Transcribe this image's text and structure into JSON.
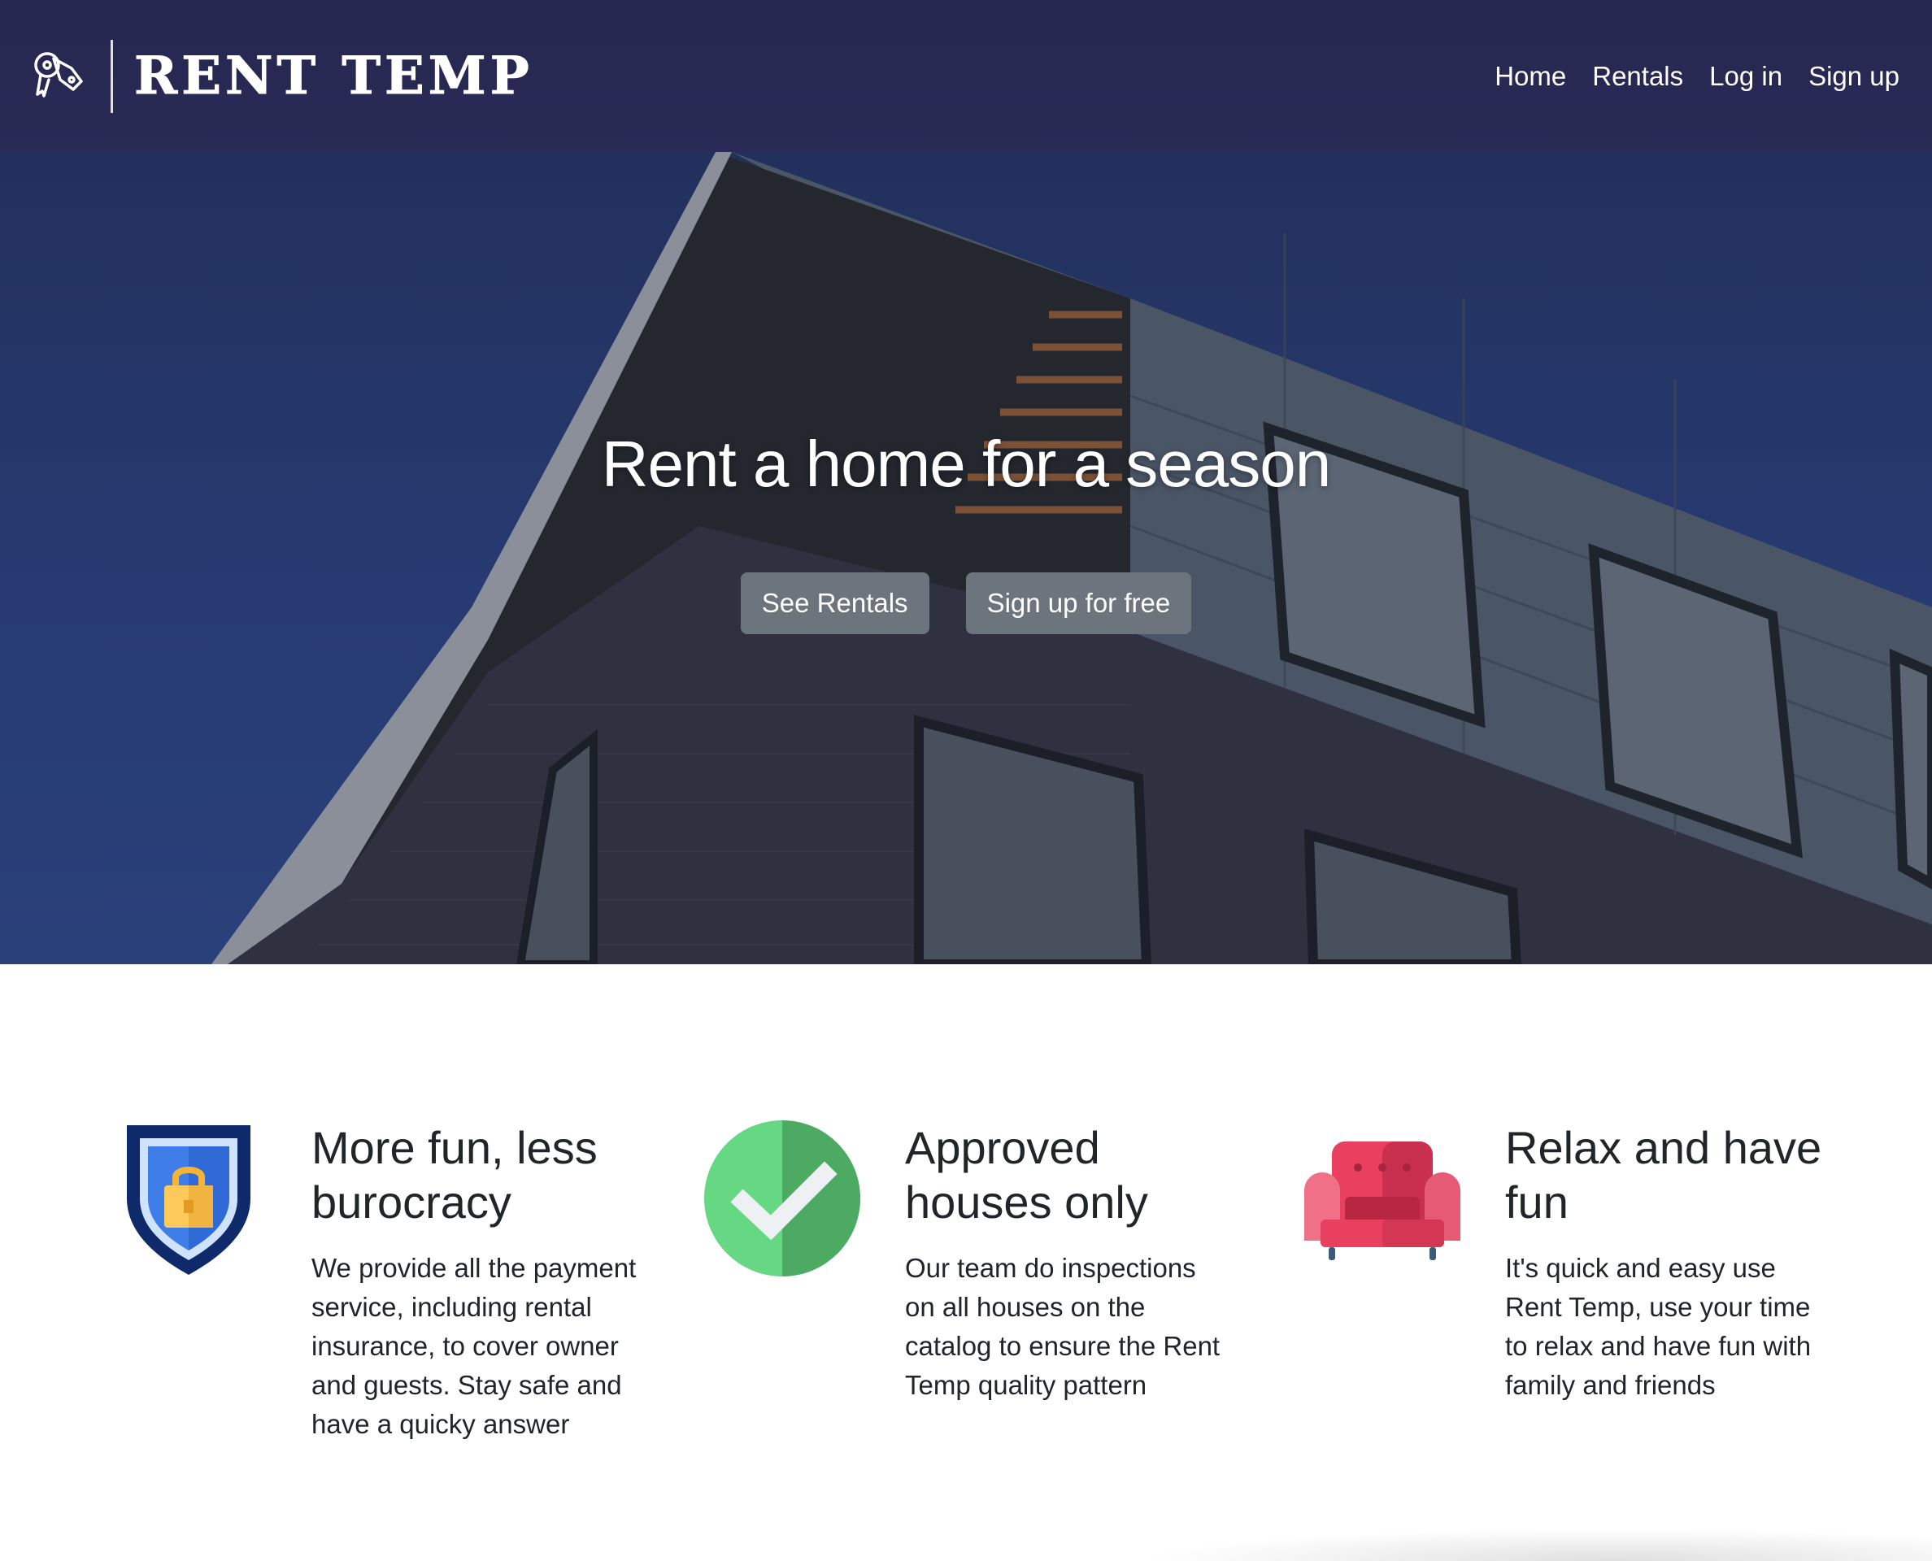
{
  "navbar": {
    "brand_name": "RENT TEMP",
    "logo_icon": "keys-icon",
    "links": [
      {
        "label": "Home"
      },
      {
        "label": "Rentals"
      },
      {
        "label": "Log in"
      },
      {
        "label": "Sign up"
      }
    ]
  },
  "hero": {
    "title": "Rent a home for a season",
    "buttons": [
      {
        "label": "See Rentals"
      },
      {
        "label": "Sign up for free"
      }
    ]
  },
  "features": [
    {
      "icon": "shield-lock-icon",
      "title": "More fun, less burocracy",
      "text": "We provide all the payment service, including rental insurance, to cover owner and guests. Stay safe and have a quicky answer"
    },
    {
      "icon": "check-circle-icon",
      "title": "Approved houses only",
      "text": "Our team do inspections on all houses on the catalog to ensure the Rent Temp quality pattern"
    },
    {
      "icon": "armchair-icon",
      "title": "Relax and have fun",
      "text": "It's quick and easy use Rent Temp, use your time to relax and have fun with family and friends"
    }
  ],
  "colors": {
    "navbar": "#272852",
    "hero_sky": "#273b72",
    "button": "#6c757d",
    "text": "#212529"
  }
}
